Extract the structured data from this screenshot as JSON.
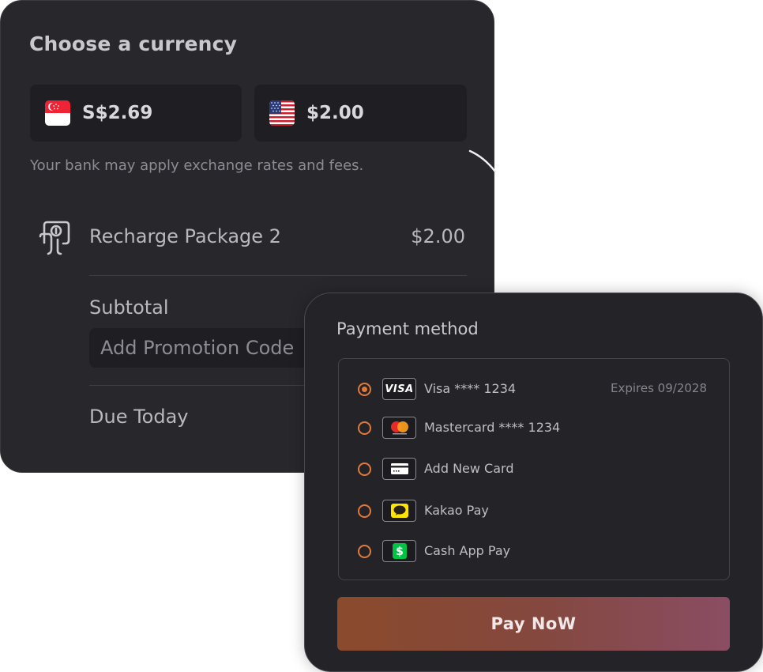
{
  "currency": {
    "title": "Choose a currency",
    "options": [
      {
        "flag": "singapore-flag-icon",
        "amount": "S$2.69"
      },
      {
        "flag": "us-flag-icon",
        "amount": "$2.00"
      }
    ],
    "note": "Your bank may apply exchange rates and fees."
  },
  "order": {
    "package_label": "Recharge Package 2",
    "package_price": "$2.00",
    "subtotal_label": "Subtotal",
    "promo_placeholder": "Add Promotion Code",
    "due_label": "Due Today"
  },
  "payment": {
    "title": "Payment method",
    "methods": [
      {
        "label": "Visa **** 1234",
        "logo": "VISA",
        "expiry": "Expires 09/2028",
        "selected": true
      },
      {
        "label": "Mastercard **** 1234",
        "logo": "mastercard-icon",
        "selected": false
      },
      {
        "label": "Add New Card",
        "logo": "card-icon",
        "selected": false
      },
      {
        "label": "Kakao Pay",
        "logo": "kakao-icon",
        "selected": false
      },
      {
        "label": "Cash App Pay",
        "logo": "cash-app-icon",
        "selected": false
      }
    ],
    "pay_button": "Pay NoW"
  },
  "colors": {
    "accent": "#e07a3a",
    "card_bg": "#28272c",
    "button_gradient_start": "#8a4a2c",
    "button_gradient_end": "#8a4d63"
  }
}
